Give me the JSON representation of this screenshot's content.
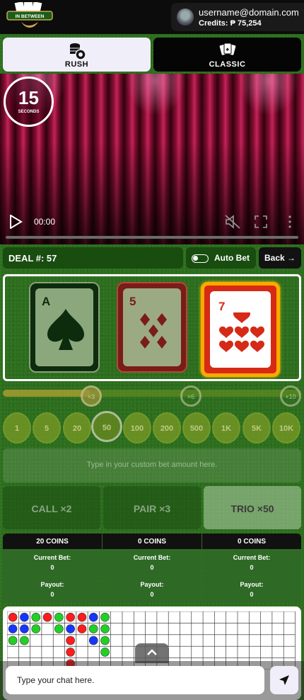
{
  "header": {
    "logo_text": "IN BETWEEN",
    "username": "username@domain.com",
    "credits": "Credits: ₱ 75,254"
  },
  "modes": {
    "rush": "RUSH",
    "classic": "CLASSIC"
  },
  "video": {
    "timer_value": "15",
    "timer_unit": "SECONDS",
    "time": "00:00"
  },
  "deal": {
    "label": "DEAL #: 57",
    "auto_bet": "Auto Bet",
    "back": "Back →"
  },
  "cards": [
    {
      "rank": "A",
      "suit": "spade"
    },
    {
      "rank": "5",
      "suit": "diamond"
    },
    {
      "rank": "7",
      "suit": "heart"
    }
  ],
  "multipliers": [
    "×3",
    "×6",
    "×10"
  ],
  "chips": [
    "1",
    "5",
    "20",
    "50",
    "100",
    "200",
    "500",
    "1K",
    "5K",
    "10K"
  ],
  "selected_chip": "50",
  "custom_bet_placeholder": "Type in your custom bet amount here.",
  "bets": [
    {
      "label": "CALL ×2",
      "coins": "20 COINS",
      "current_label": "Current Bet:",
      "current": "0",
      "payout_label": "Payout:",
      "payout": "0"
    },
    {
      "label": "PAIR  ×3",
      "coins": "0 COINS",
      "current_label": "Current Bet:",
      "current": "0",
      "payout_label": "Payout:",
      "payout": "0"
    },
    {
      "label": "TRIO ×50",
      "coins": "0 COINS",
      "current_label": "Current Bet:",
      "current": "0",
      "payout_label": "Payout:",
      "payout": "0"
    }
  ],
  "roadmap": {
    "colors": {
      "red": "#ff1c1c",
      "blue": "#1636ff",
      "green": "#22d024"
    },
    "columns": [
      [
        "red",
        "blue",
        "green"
      ],
      [
        "blue",
        "blue",
        "green"
      ],
      [
        "green",
        "green"
      ],
      [
        "red"
      ],
      [
        "green",
        "green"
      ],
      [
        "red",
        "blue",
        "red",
        "red",
        "red"
      ],
      [
        "red",
        "red"
      ],
      [
        "blue",
        "green",
        "blue"
      ],
      [
        "green",
        "green",
        "green",
        "green"
      ]
    ]
  },
  "chat": {
    "placeholder": "Type your chat here."
  }
}
